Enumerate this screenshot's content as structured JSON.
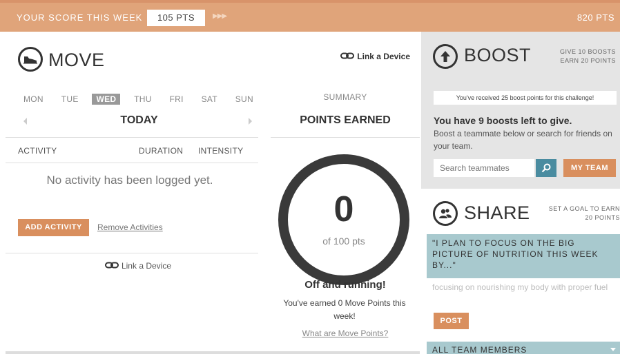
{
  "topbar": {
    "label": "YOUR SCORE THIS WEEK",
    "score": "105 PTS",
    "arrows": "▶▶▶",
    "total": "820 PTS"
  },
  "move": {
    "title": "MOVE",
    "icon": "shoe-icon",
    "link_device": "Link a Device",
    "days": [
      "MON",
      "TUE",
      "WED",
      "THU",
      "FRI",
      "SAT",
      "SUN"
    ],
    "active_day": "WED",
    "today": "TODAY",
    "columns": {
      "activity": "ACTIVITY",
      "duration": "DURATION",
      "intensity": "INTENSITY"
    },
    "empty_message": "No activity has been logged yet.",
    "add_activity": "ADD ACTIVITY",
    "remove_activities": "Remove Activities",
    "link_device_bottom": "Link a Device"
  },
  "summary": {
    "label": "SUMMARY",
    "points_earned": "POINTS EARNED",
    "points": "0",
    "of_total": "of 100 pts",
    "status": "Off and running!",
    "earned_text": "You've earned 0 Move Points this week!",
    "what_link": "What are Move Points?"
  },
  "boost": {
    "title": "BOOST",
    "icon": "up-arrow-icon",
    "note_line1": "GIVE 10 BOOSTS",
    "note_line2": "EARN 20 POINTS",
    "banner": "You've received 25 boost points for this challenge!",
    "boosts_left": "You have 9 boosts left to give.",
    "description": "Boost a teammate below or search for friends on your team.",
    "search_placeholder": "Search teammates",
    "my_team": "MY TEAM"
  },
  "share": {
    "title": "SHARE",
    "icon": "people-icon",
    "note_line1": "SET A GOAL TO EARN",
    "note_line2": "20 POINTS",
    "quote": "\"I PLAN TO FOCUS ON THE BIG PICTURE OF NUTRITION THIS WEEK BY...\"",
    "answer": "focusing on nourishing my body with proper fuel",
    "post": "POST",
    "team_members": "ALL TEAM MEMBERS"
  },
  "colors": {
    "orange": "#d98f5e",
    "topbar": "#e0a47a",
    "teal": "#4a8ca0",
    "light_teal": "#a8c9ce",
    "gray_panel": "#e5e5e5"
  }
}
